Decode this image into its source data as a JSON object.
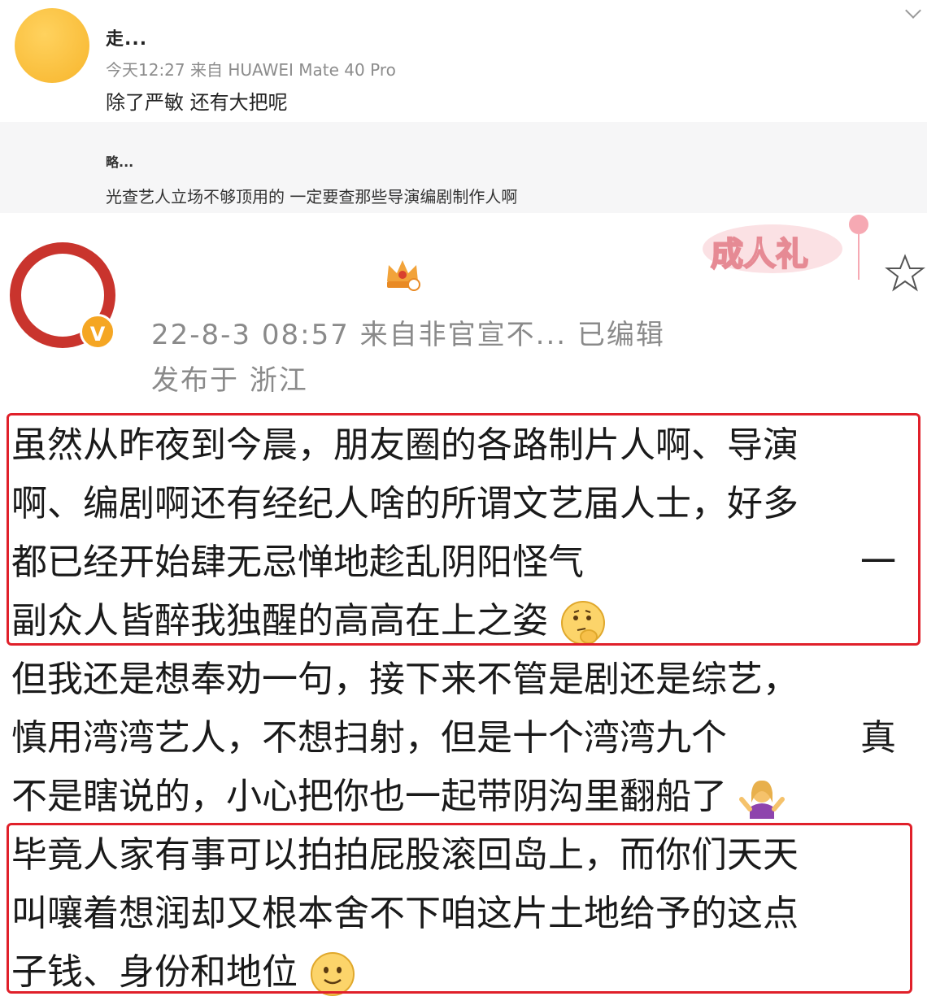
{
  "reply": {
    "username": "走...",
    "meta": "今天12:27  来自 HUAWEI Mate 40 Pro",
    "comment": "除了严敏 还有大把呢",
    "sub_username": "略...",
    "sub_comment": "光查艺人立场不够顶用的 一定要查那些导演编剧制作人啊"
  },
  "post": {
    "badge_text": "成人礼",
    "verified_label": "V",
    "meta": "22-8-3 08:57  来自非官宣不...   已编辑",
    "location": "发布于 浙江",
    "lines": [
      "虽然从昨夜到今晨，朋友圈的各路制片人啊、导演",
      "啊、编剧啊还有经纪人啥的所谓文艺届人士，好多",
      "都已经开始肆无忌惮地趁乱阴阳怪气",
      "副众人皆醉我独醒的高高在上之姿",
      "但我还是想奉劝一句，接下来不管是剧还是综艺，",
      "慎用湾湾艺人，不想扫射，但是十个湾湾九个",
      "不是瞎说的，小心把你也一起带阴沟里翻船了",
      "毕竟人家有事可以拍拍屁股滚回岛上，而你们天天",
      "叫嚷着想润却又根本舍不下咱这片土地给予的这点",
      "子钱、身份和地位"
    ],
    "line3_tail": "一",
    "line6_tail": "真"
  },
  "colors": {
    "highlight_border": "#e0202a",
    "meta_gray": "#8a8a8a",
    "avatar_red": "#c9342d",
    "vip_gold": "#f5a623"
  },
  "icons": [
    "chevron-down-icon",
    "crown-vip-icon",
    "coming-of-age-badge-icon",
    "star-icon",
    "thinking-face-icon",
    "shrug-woman-icon",
    "smile-face-icon"
  ]
}
